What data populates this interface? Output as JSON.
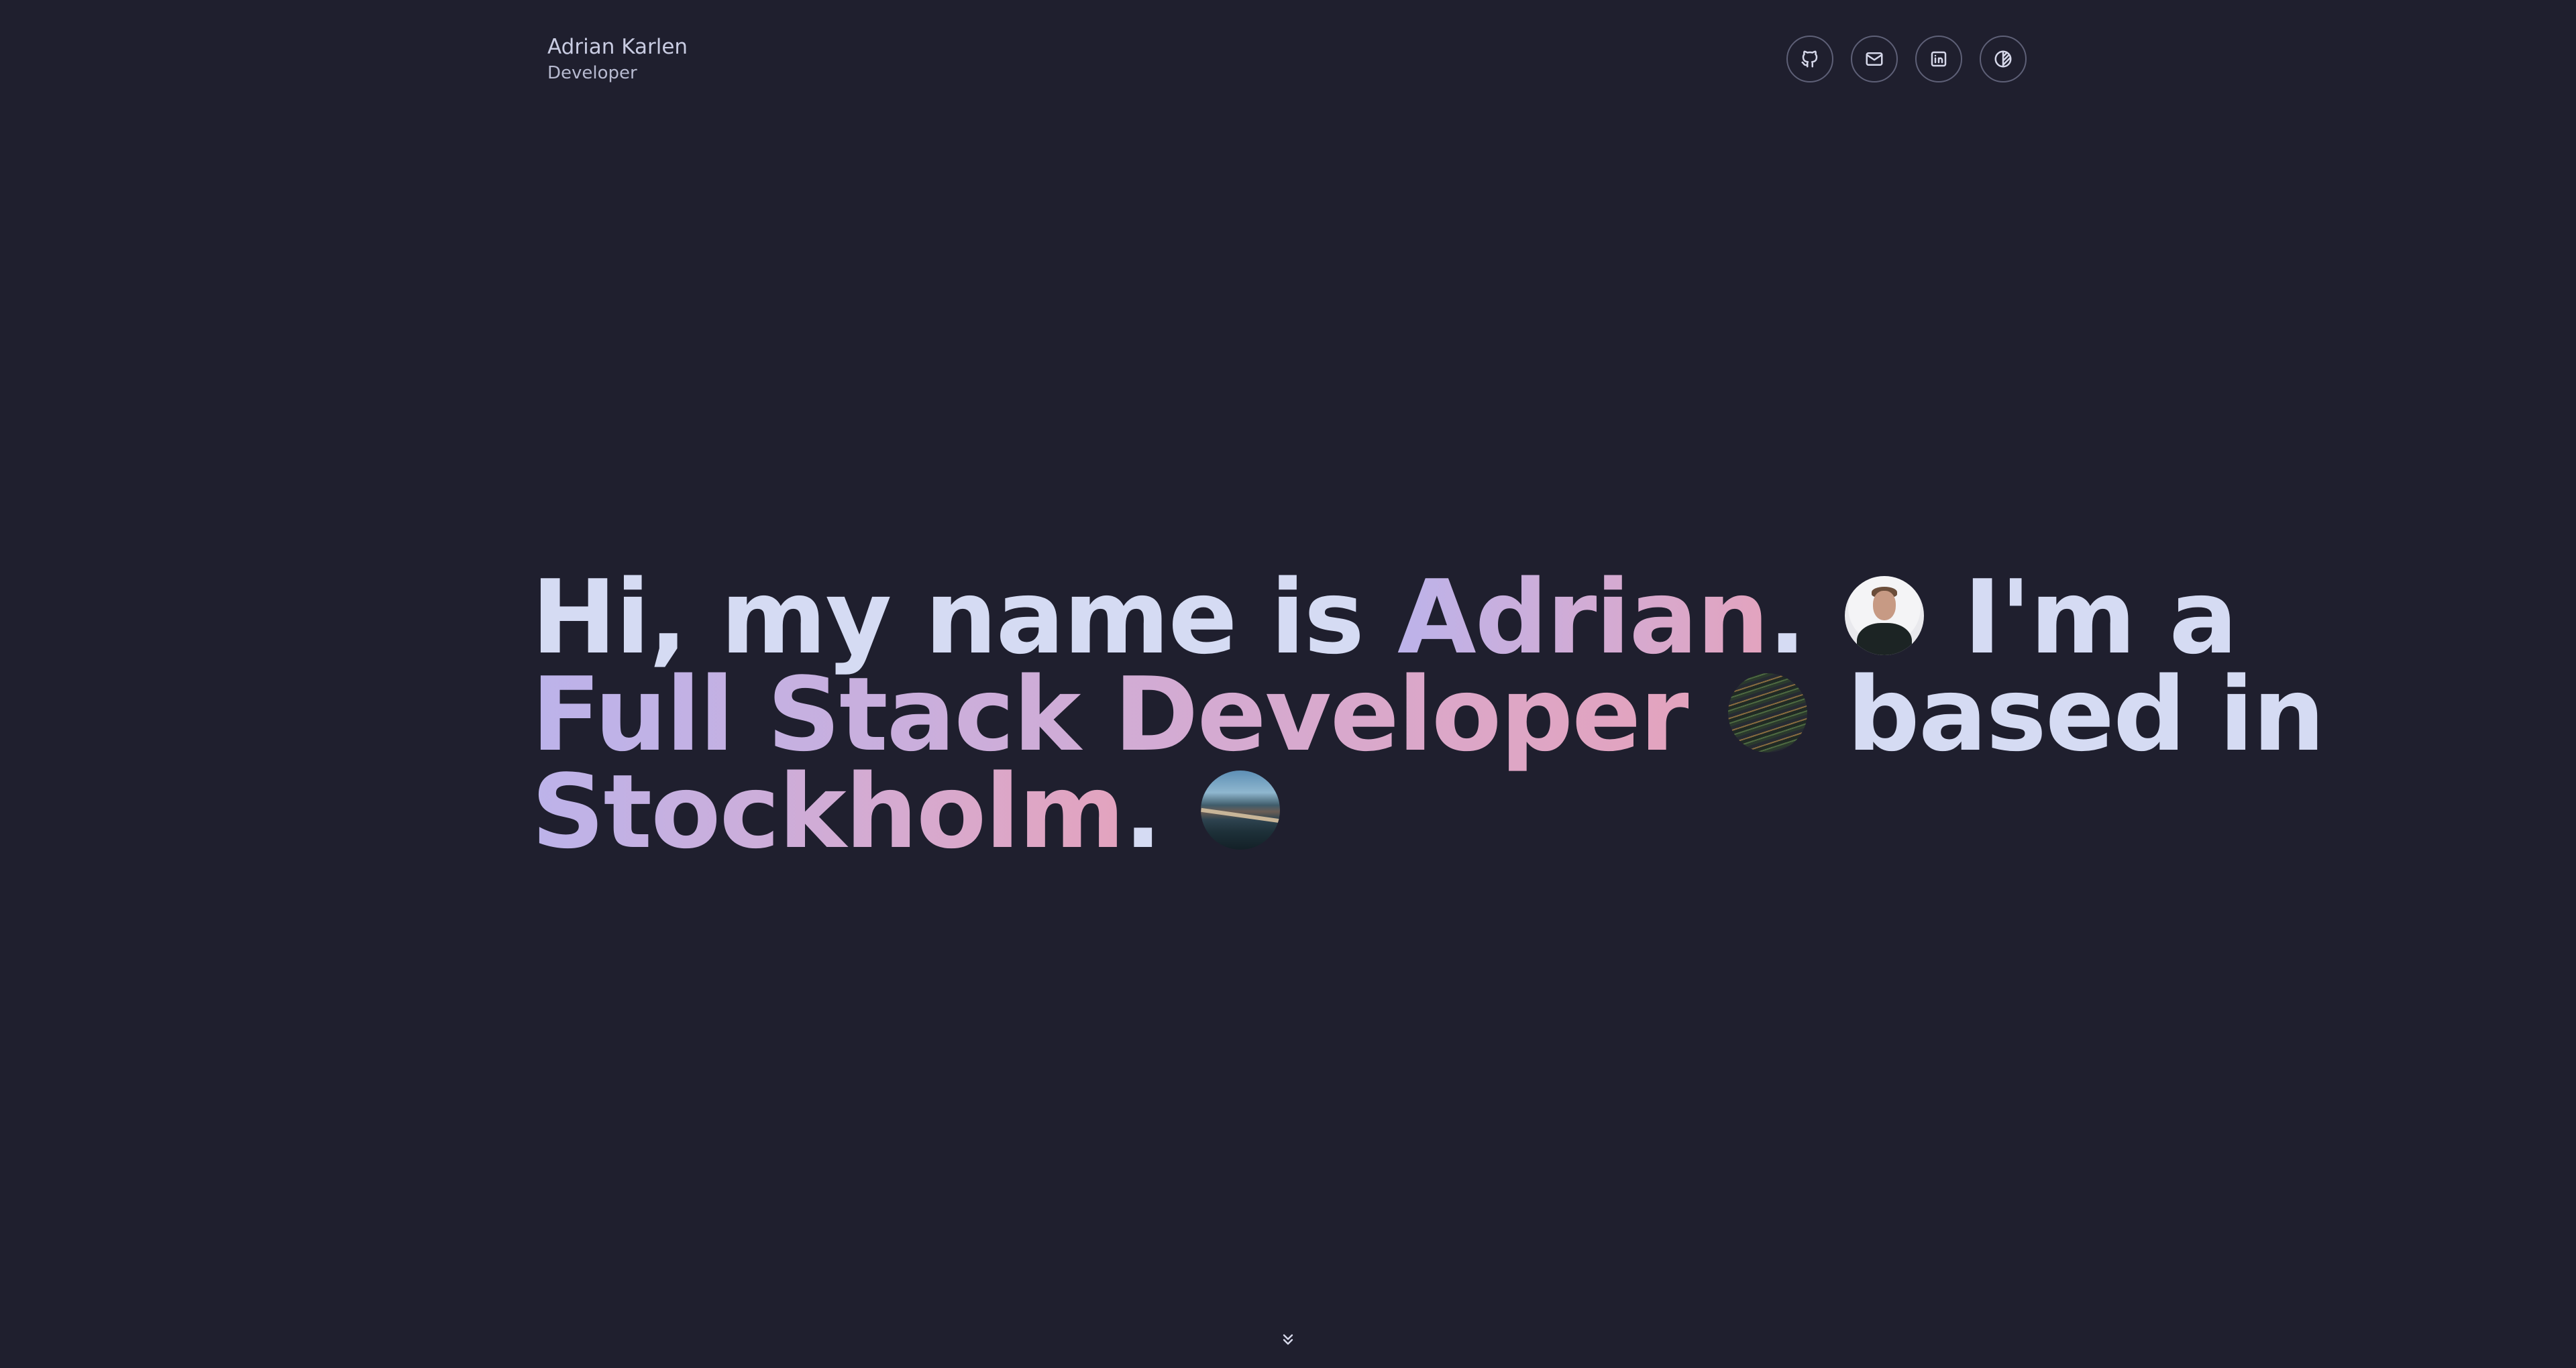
{
  "header": {
    "name": "Adrian Karlen",
    "role": "Developer"
  },
  "social": [
    {
      "icon": "github-icon"
    },
    {
      "icon": "mail-icon"
    },
    {
      "icon": "linkedin-icon"
    },
    {
      "icon": "theme-toggle-icon"
    }
  ],
  "hero": {
    "line1_plain_1": "Hi, my name is ",
    "line1_name": "Adrian",
    "line1_plain_2": ". ",
    "line1_plain_3": " I'm a",
    "line2_role": "Full Stack Developer",
    "line2_plain": " based in",
    "line3_city": "Stockholm",
    "line3_plain": "."
  },
  "colors": {
    "background": "#1f1f2e",
    "text": "#d5dbf3",
    "gradient_start": "#bcb3ea",
    "gradient_end": "#e3a3be"
  },
  "scroll_icon": "chevrons-down-icon"
}
